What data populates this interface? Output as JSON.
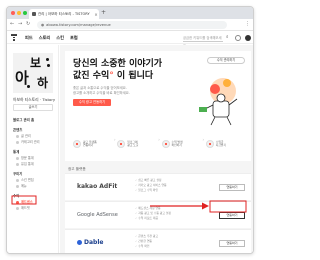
{
  "browser": {
    "tab_title": "관리 | 아보하 티스토리 - TISTORY",
    "tab_close": "×",
    "new_tab": "+",
    "back": "←",
    "forward": "→",
    "reload": "↻",
    "url": "abowa.tistory.com/manage/revenue",
    "menu": "⋮"
  },
  "tistory": {
    "nav": [
      "피드",
      "스토리",
      "스킨",
      "포럼"
    ],
    "search_placeholder": "궁금한 키워드를 검색해보세요",
    "search_icon": "search-icon"
  },
  "sidebar": {
    "avatar_letters": [
      "아",
      "보",
      "하"
    ],
    "blog_name": "아보하 티스토리 · Tistory",
    "write_button": "글쓰기",
    "groups": [
      {
        "label": "블로그 관리 홈",
        "items": []
      },
      {
        "label": "콘텐츠",
        "items": [
          "글 관리",
          "카테고리 관리"
        ]
      },
      {
        "label": "통계",
        "items": [
          "방문 통계",
          "유입 통계"
        ]
      },
      {
        "label": "꾸미기",
        "items": [
          "스킨 편집",
          "메뉴"
        ]
      },
      {
        "label": "수익",
        "items": [
          "애드센스",
          "애드핏"
        ]
      }
    ],
    "active_item": "애드센스"
  },
  "main": {
    "headline_line1": "당신의 소중한 이야기가",
    "headline_line2_pre": "값진 수익",
    "headline_line2_post": "이 됩니다",
    "description": [
      "좋은 글과 소통으로 수익을 얻어보세요.",
      "광고를 소개하고 수익을 바로 확인하세요."
    ],
    "primary_button": "수익 광고 연동하기",
    "secondary_button": "수익 관리하기",
    "steps": [
      {
        "text": [
          "광고 플랫폼",
          "연동하기"
        ]
      },
      {
        "text": [
          "블로그에",
          "광고 노출"
        ]
      },
      {
        "text": [
          "수익 발생",
          "확인하기"
        ]
      },
      {
        "text": [
          "수익금",
          "지급받기"
        ]
      }
    ],
    "step_arrow": "›",
    "section_title": "광고 플랫폼",
    "ad_platforms": [
      {
        "name": "kakao AdFit",
        "features": [
          "쉽고 빠른 광고 설정",
          "카카오 광고 서비스 연동",
          "블로그 수익 확인"
        ],
        "button": "연동하기"
      },
      {
        "name": "Google AdSense",
        "features": [
          "애드센스 계정 연동",
          "자동 광고 및 수동 광고 설정",
          "수익 리포트 제공"
        ],
        "button": "연동하기"
      },
      {
        "name": "Dable",
        "features": [
          "콘텐츠 추천 광고",
          "간편한 연동",
          "수익 확인"
        ],
        "button": "연동하기"
      }
    ]
  },
  "colors": {
    "accent": "#ff5a4a",
    "annotation_red": "#e02020"
  }
}
